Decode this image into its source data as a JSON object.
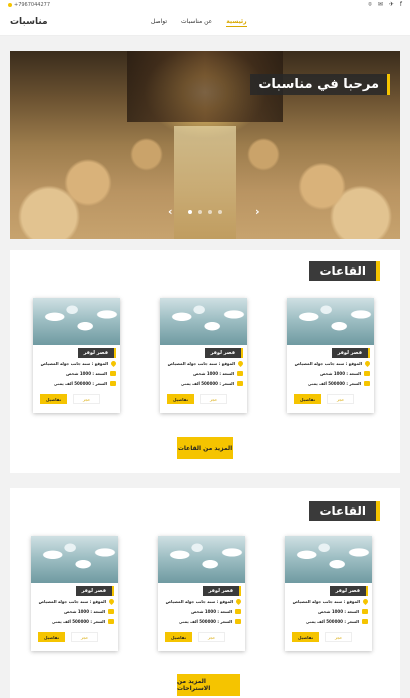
{
  "topbar": {
    "phone": "+7967044277",
    "social": [
      "f",
      "✈",
      "✉",
      "⌾"
    ]
  },
  "nav": {
    "logo": "مناسبات",
    "menu": [
      {
        "label": "رئيسية",
        "active": true
      },
      {
        "label": "عن مناسبات",
        "active": false
      },
      {
        "label": "تواصل",
        "active": false
      }
    ]
  },
  "hero": {
    "title": "مرحبا في مناسبات",
    "prev_icon": "chevron-left-icon",
    "next_icon": "chevron-right-icon",
    "slide_count": 4,
    "active_slide": 1
  },
  "sections": [
    {
      "title": "القاعات",
      "more_label": "المزيد من القاعات",
      "cards": [
        {
          "name": "قصر لوفر",
          "location": "الموقع : سنة جانب جولة المصياص",
          "capacity": "السعة : 1000 شخص",
          "price": "السعر : 500000 ألف يمني",
          "details_label": "تفاصيل",
          "book_label": "حجز"
        },
        {
          "name": "قصر لوفر",
          "location": "الموقع : سنة جانب جولة المصياص",
          "capacity": "السعة : 1000 شخص",
          "price": "السعر : 500000 ألف يمني",
          "details_label": "تفاصيل",
          "book_label": "حجز"
        },
        {
          "name": "قصر لوفر",
          "location": "الموقع : سنة جانب جولة المصياص",
          "capacity": "السعة : 1000 شخص",
          "price": "السعر : 500000 ألف يمني",
          "details_label": "تفاصيل",
          "book_label": "حجز"
        }
      ]
    },
    {
      "title": "القاعات",
      "more_label": "المزيد من الاستراحات",
      "cards": [
        {
          "name": "قصر لوفر",
          "location": "الموقع : سنة جانب جولة المصياص",
          "capacity": "السعة : 1000 شخص",
          "price": "السعر : 500000 ألف يمني",
          "details_label": "تفاصيل",
          "book_label": "حجز"
        },
        {
          "name": "قصر لوفر",
          "location": "الموقع : سنة جانب جولة المصياص",
          "capacity": "السعة : 1000 شخص",
          "price": "السعر : 500000 ألف يمني",
          "details_label": "تفاصيل",
          "book_label": "حجز"
        },
        {
          "name": "قصر لوفر",
          "location": "الموقع : سنة جانب جولة المصياص",
          "capacity": "السعة : 1000 شخص",
          "price": "السعر : 500000 ألف يمني",
          "details_label": "تفاصيل",
          "book_label": "حجز"
        }
      ]
    }
  ],
  "colors": {
    "accent": "#f5c400",
    "dark": "#3a3a3a"
  }
}
